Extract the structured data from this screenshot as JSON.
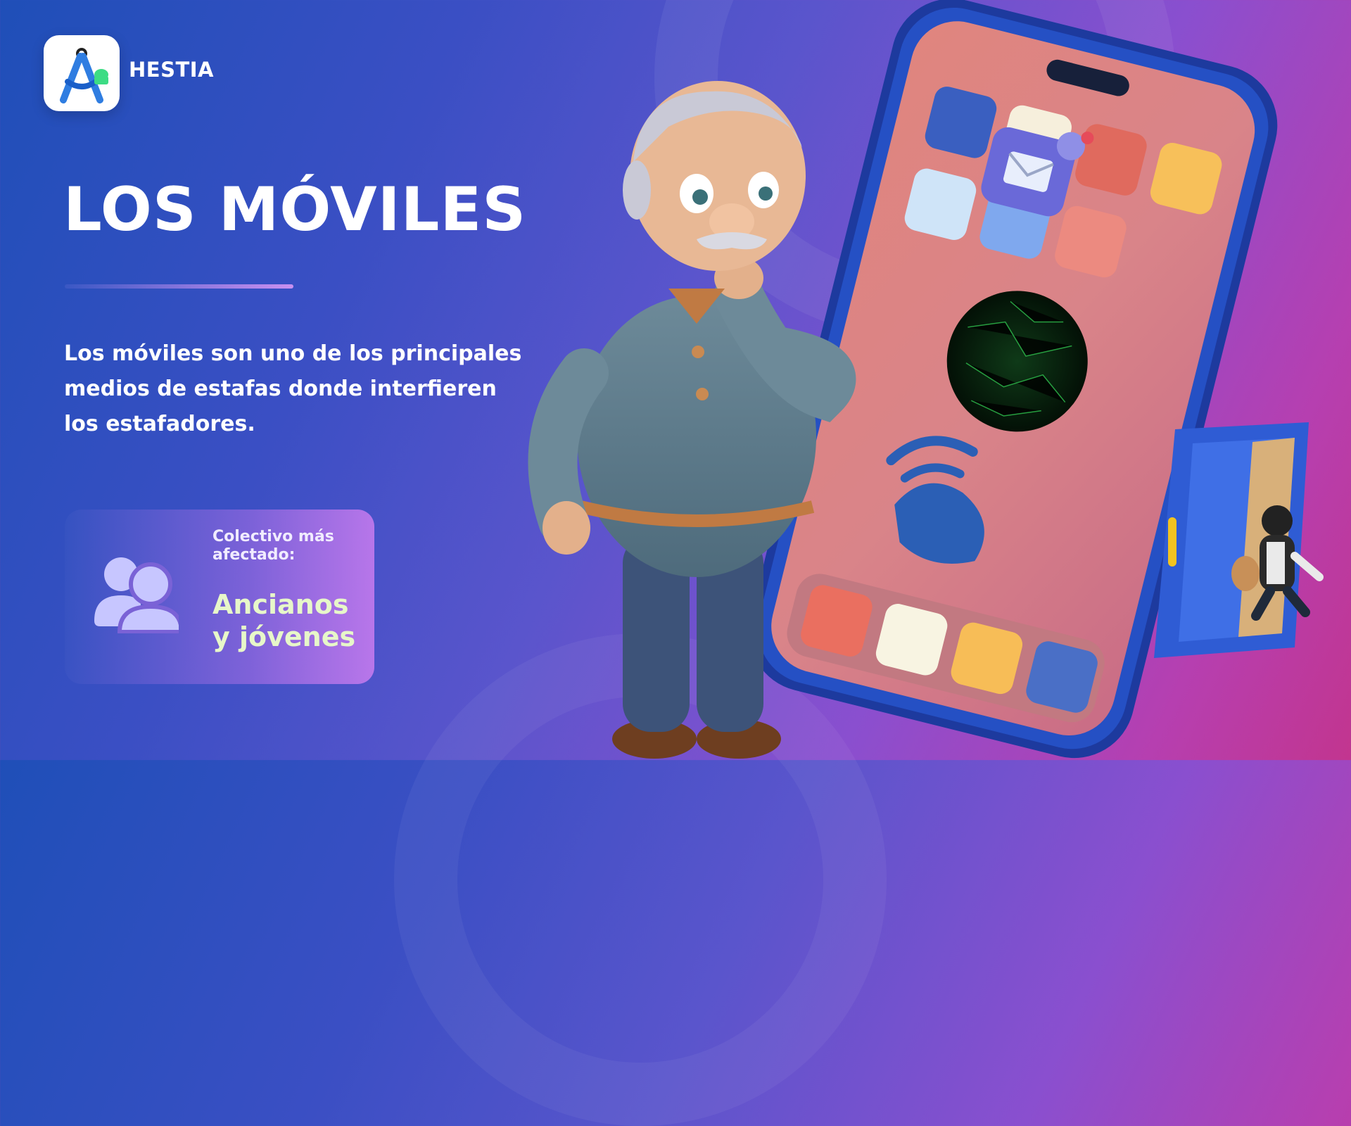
{
  "brand": {
    "name": "HESTIA",
    "logo_icon": "compass-android-icon"
  },
  "title": "LOS MÓVILES",
  "description": "Los móviles son uno de los principales medios de estafas donde interfieren los estafadores.",
  "info_card": {
    "icon": "users-icon",
    "label": "Colectivo más afectado:",
    "value": "Ancianos y jóvenes"
  },
  "illustration": {
    "elements": [
      "worried-elderly-man",
      "smartphone",
      "mail-notification-icon",
      "phone-call-icon",
      "hacker-globe",
      "door",
      "thief-with-bag"
    ],
    "notification_count": "1"
  },
  "colors": {
    "bg_start": "#1f4fb8",
    "bg_end": "#c2358f",
    "accent_line": "#c890f0",
    "card_value": "#e7f7c9",
    "icon_tint": "#c7c6ff"
  }
}
